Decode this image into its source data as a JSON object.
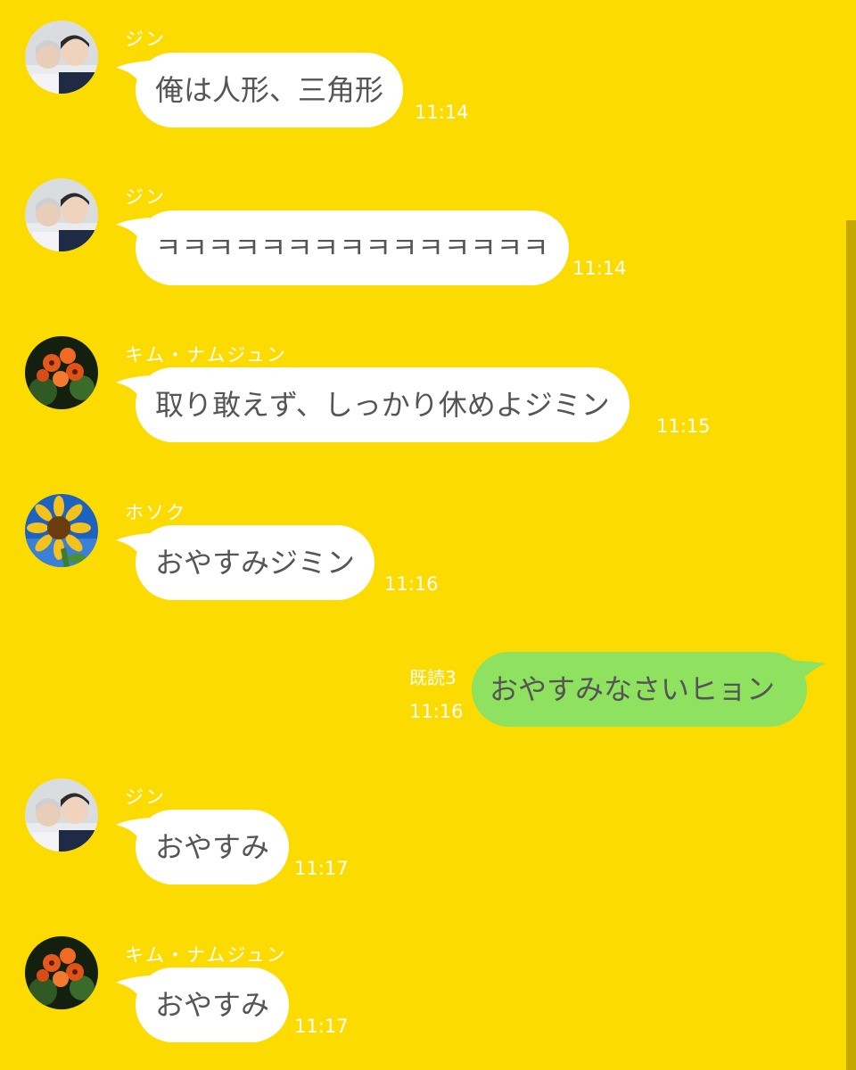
{
  "messages": [
    {
      "sender": "ジン",
      "text": "俺は人形、三角形",
      "time": "11:14",
      "avatar": "jin-avatar"
    },
    {
      "sender": "ジン",
      "text": "ㅋㅋㅋㅋㅋㅋㅋㅋㅋㅋㅋㅋㅋㅋㅋ",
      "time": "11:14",
      "avatar": "jin-avatar"
    },
    {
      "sender": "キム・ナムジュン",
      "text": "取り敢えず、しっかり休めよジミン",
      "time": "11:15",
      "avatar": "lily-avatar"
    },
    {
      "sender": "ホソク",
      "text": "おやすみジミン",
      "time": "11:16",
      "avatar": "sunflower-avatar"
    },
    {
      "sender": "ジン",
      "text": "おやすみ",
      "time": "11:17",
      "avatar": "jin-avatar"
    },
    {
      "sender": "キム・ナムジュン",
      "text": "おやすみ",
      "time": "11:17",
      "avatar": "lily-avatar"
    }
  ],
  "my_message": {
    "read_label": "既読3",
    "text": "おやすみなさいヒョン",
    "time": "11:16"
  },
  "colors": {
    "background": "#FCDC00",
    "my_bubble": "#8FE160",
    "other_bubble": "#FFFFFF",
    "scrollbar": "#C4A800"
  }
}
